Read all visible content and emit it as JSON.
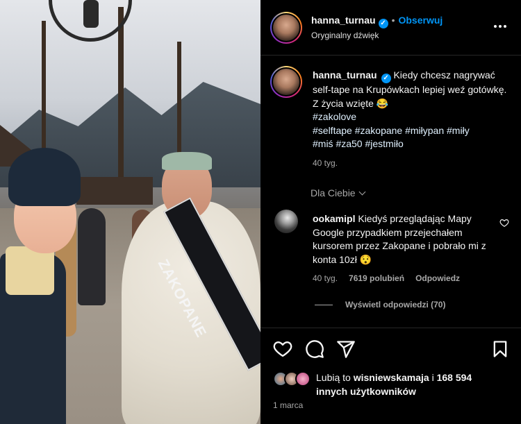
{
  "media": {
    "sash_text": "ZAKOPANE"
  },
  "header": {
    "username": "hanna_turnau",
    "follow_label": "Obserwuj",
    "subtitle": "Oryginalny dźwięk"
  },
  "caption": {
    "username": "hanna_turnau",
    "text": "Kiedy chcesz nagrywać self-tape na Krupówkach lepiej weź gotówkę. Z życia wzięte 😂",
    "hashtags_line1": "#zakolove",
    "hashtags_line2": "#selftape #zakopane #miłypan #miły",
    "hashtags_line3": "#miś #za50 #jestmiło",
    "time": "40 tyg."
  },
  "filter": {
    "label": "Dla Ciebie"
  },
  "comment": {
    "username": "ookamipl",
    "text": "Kiedyś przeglądając Mapy Google przypadkiem przejechałem kursorem przez Zakopane i pobrało mi z konta 10zł 😯",
    "time": "40 tyg.",
    "likes": "7619 polubień",
    "reply_label": "Odpowiedz",
    "view_replies": "Wyświetl odpowiedzi (70)"
  },
  "actions": {
    "like_icon": "heart-icon",
    "comment_icon": "comment-icon",
    "share_icon": "send-icon",
    "save_icon": "bookmark-icon"
  },
  "likes": {
    "prefix": "Lubią to",
    "user": "wisniewskamaja",
    "middle": "i",
    "count": "168 594",
    "suffix": "innych użytkowników"
  },
  "date": "1 marca",
  "colors": {
    "accent": "#0095f6",
    "background": "#000000",
    "muted": "#a8a8a8"
  }
}
